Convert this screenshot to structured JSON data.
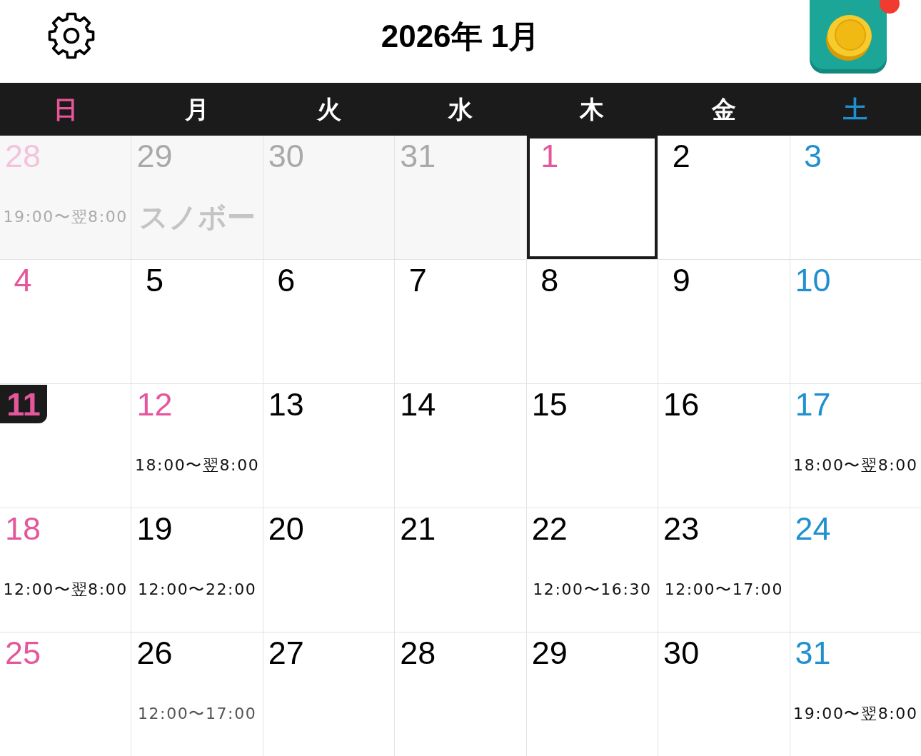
{
  "header": {
    "title": "2026年 1月"
  },
  "weekdays": [
    {
      "label": "日",
      "kind": "sunday"
    },
    {
      "label": "月",
      "kind": "weekday"
    },
    {
      "label": "火",
      "kind": "weekday"
    },
    {
      "label": "水",
      "kind": "weekday"
    },
    {
      "label": "木",
      "kind": "weekday"
    },
    {
      "label": "金",
      "kind": "weekday"
    },
    {
      "label": "土",
      "kind": "saturday"
    }
  ],
  "weeks": [
    [
      {
        "date": "28",
        "kind": "sunday",
        "outside": true,
        "today": false,
        "selected": false,
        "events": [
          {
            "kind": "time",
            "text": "19:00〜翌8:00",
            "color": "#aaaaaa"
          }
        ]
      },
      {
        "date": "29",
        "kind": "weekday",
        "outside": true,
        "today": false,
        "selected": false,
        "events": [
          {
            "kind": "memo",
            "text": "スノボー",
            "color": "#c4c4c4"
          }
        ]
      },
      {
        "date": "30",
        "kind": "weekday",
        "outside": true,
        "today": false,
        "selected": false
      },
      {
        "date": "31",
        "kind": "weekday",
        "outside": true,
        "today": false,
        "selected": false
      },
      {
        "date": "1",
        "kind": "holiday",
        "outside": false,
        "today": false,
        "selected": true
      },
      {
        "date": "2",
        "kind": "weekday",
        "outside": false,
        "today": false,
        "selected": false
      },
      {
        "date": "3",
        "kind": "saturday",
        "outside": false,
        "today": false,
        "selected": false
      }
    ],
    [
      {
        "date": "4",
        "kind": "sunday",
        "outside": false,
        "today": false,
        "selected": false
      },
      {
        "date": "5",
        "kind": "weekday",
        "outside": false,
        "today": false,
        "selected": false
      },
      {
        "date": "6",
        "kind": "weekday",
        "outside": false,
        "today": false,
        "selected": false
      },
      {
        "date": "7",
        "kind": "weekday",
        "outside": false,
        "today": false,
        "selected": false
      },
      {
        "date": "8",
        "kind": "weekday",
        "outside": false,
        "today": false,
        "selected": false
      },
      {
        "date": "9",
        "kind": "weekday",
        "outside": false,
        "today": false,
        "selected": false
      },
      {
        "date": "10",
        "kind": "saturday",
        "outside": false,
        "today": false,
        "selected": false
      }
    ],
    [
      {
        "date": "11",
        "kind": "sunday",
        "outside": false,
        "today": true,
        "selected": false
      },
      {
        "date": "12",
        "kind": "holiday",
        "outside": false,
        "today": false,
        "selected": false,
        "events": [
          {
            "kind": "time",
            "text": "18:00〜翌8:00",
            "color": "#111111"
          }
        ]
      },
      {
        "date": "13",
        "kind": "weekday",
        "outside": false,
        "today": false,
        "selected": false
      },
      {
        "date": "14",
        "kind": "weekday",
        "outside": false,
        "today": false,
        "selected": false
      },
      {
        "date": "15",
        "kind": "weekday",
        "outside": false,
        "today": false,
        "selected": false
      },
      {
        "date": "16",
        "kind": "weekday",
        "outside": false,
        "today": false,
        "selected": false
      },
      {
        "date": "17",
        "kind": "saturday",
        "outside": false,
        "today": false,
        "selected": false,
        "events": [
          {
            "kind": "time",
            "text": "18:00〜翌8:00",
            "color": "#111111"
          }
        ]
      }
    ],
    [
      {
        "date": "18",
        "kind": "sunday",
        "outside": false,
        "today": false,
        "selected": false,
        "events": [
          {
            "kind": "time",
            "text": "12:00〜翌8:00",
            "color": "#111111"
          }
        ]
      },
      {
        "date": "19",
        "kind": "weekday",
        "outside": false,
        "today": false,
        "selected": false,
        "events": [
          {
            "kind": "time",
            "text": "12:00〜22:00",
            "color": "#111111"
          }
        ]
      },
      {
        "date": "20",
        "kind": "weekday",
        "outside": false,
        "today": false,
        "selected": false
      },
      {
        "date": "21",
        "kind": "weekday",
        "outside": false,
        "today": false,
        "selected": false
      },
      {
        "date": "22",
        "kind": "weekday",
        "outside": false,
        "today": false,
        "selected": false,
        "events": [
          {
            "kind": "time",
            "text": "12:00〜16:30",
            "color": "#111111"
          }
        ]
      },
      {
        "date": "23",
        "kind": "weekday",
        "outside": false,
        "today": false,
        "selected": false,
        "events": [
          {
            "kind": "time",
            "text": "12:00〜17:00",
            "color": "#111111"
          }
        ]
      },
      {
        "date": "24",
        "kind": "saturday",
        "outside": false,
        "today": false,
        "selected": false
      }
    ],
    [
      {
        "date": "25",
        "kind": "sunday",
        "outside": false,
        "today": false,
        "selected": false
      },
      {
        "date": "26",
        "kind": "weekday",
        "outside": false,
        "today": false,
        "selected": false,
        "events": [
          {
            "kind": "time",
            "text": "12:00〜17:00",
            "color": "#555555"
          }
        ]
      },
      {
        "date": "27",
        "kind": "weekday",
        "outside": false,
        "today": false,
        "selected": false
      },
      {
        "date": "28",
        "kind": "weekday",
        "outside": false,
        "today": false,
        "selected": false
      },
      {
        "date": "29",
        "kind": "weekday",
        "outside": false,
        "today": false,
        "selected": false
      },
      {
        "date": "30",
        "kind": "weekday",
        "outside": false,
        "today": false,
        "selected": false
      },
      {
        "date": "31",
        "kind": "saturday",
        "outside": false,
        "today": false,
        "selected": false,
        "events": [
          {
            "kind": "time",
            "text": "19:00〜翌8:00",
            "color": "#111111"
          }
        ]
      }
    ]
  ]
}
